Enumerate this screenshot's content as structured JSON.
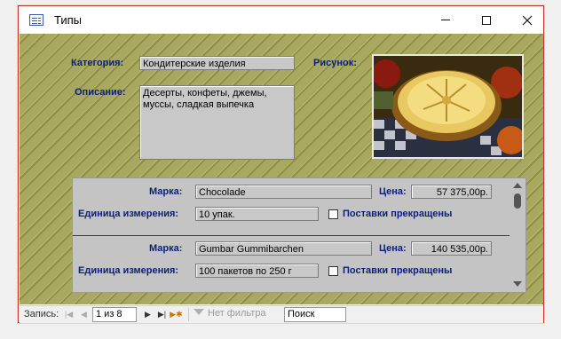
{
  "window": {
    "title": "Типы",
    "icon": "form-icon"
  },
  "form": {
    "category_label": "Категория:",
    "category_value": "Кондитерские изделия",
    "description_label": "Описание:",
    "description_value": "Десерты, конфеты, джемы, муссы, сладкая выпечка",
    "picture_label": "Рисунок:",
    "picture_alt": "pie-image"
  },
  "subform": {
    "records": [
      {
        "brand_label": "Марка:",
        "brand_value": "Chocolade",
        "price_label": "Цена:",
        "price_value": "57 375,00р.",
        "unit_label": "Единица измерения:",
        "unit_value": "10 упак.",
        "discontinued_label": "Поставки прекращены",
        "discontinued": false
      },
      {
        "brand_label": "Марка:",
        "brand_value": "Gumbar Gummibarchen",
        "price_label": "Цена:",
        "price_value": "140 535,00р.",
        "unit_label": "Единица измерения:",
        "unit_value": "100 пакетов по 250 г",
        "discontinued_label": "Поставки прекращены",
        "discontinued": false
      }
    ]
  },
  "navigation": {
    "record_label": "Запись:",
    "position": "1 из 8",
    "filter_label": "Нет фильтра",
    "search_label": "Поиск"
  },
  "colors": {
    "label": "#0b1f7a",
    "background": "#a8a860",
    "field": "#c8c8c8",
    "window_border": "#c0392b"
  }
}
